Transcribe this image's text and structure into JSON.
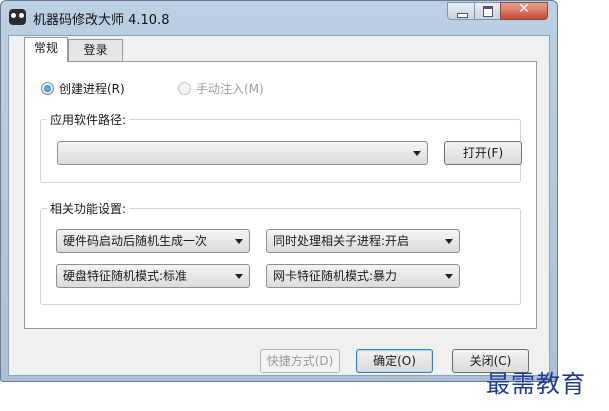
{
  "window": {
    "title": "机器码修改大师 4.10.8",
    "close_glyph": "✕"
  },
  "tabs": [
    {
      "label": "常规",
      "active": true
    },
    {
      "label": "登录",
      "active": false
    }
  ],
  "mode": {
    "create_process": {
      "label": "创建进程(R)",
      "checked": true
    },
    "manual_inject": {
      "label": "手动注入(M)",
      "enabled": false
    }
  },
  "path_group": {
    "legend": "应用软件路径:",
    "path_value": "",
    "open_button": "打开(F)"
  },
  "settings_group": {
    "legend": "相关功能设置:",
    "combos": [
      "硬件码启动后随机生成一次",
      "同时处理相关子进程:开启",
      "硬盘特征随机模式:标准",
      "网卡特征随机模式:暴力"
    ]
  },
  "footer": {
    "shortcut_button": "快捷方式(D)",
    "ok_button": "确定(O)",
    "close_button": "关闭(C)"
  },
  "watermark": "最需教育"
}
